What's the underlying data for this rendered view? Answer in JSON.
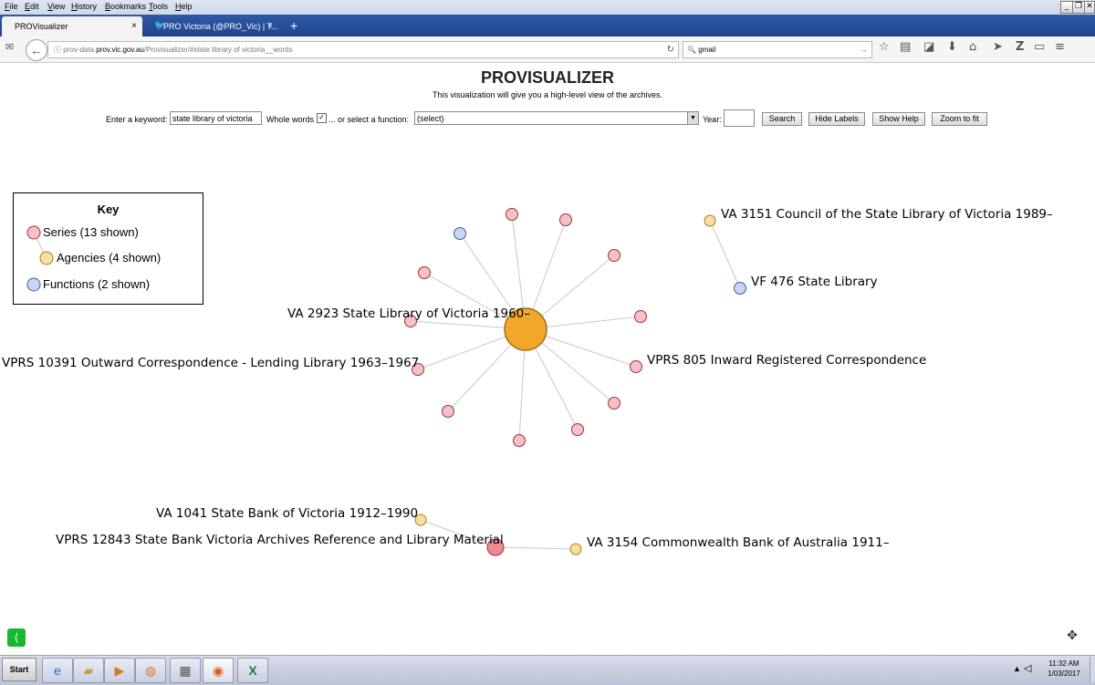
{
  "menu": [
    "File",
    "Edit",
    "View",
    "History",
    "Bookmarks",
    "Tools",
    "Help"
  ],
  "tabs": [
    {
      "title": "PROVisualizer",
      "close": "×"
    },
    {
      "title": "PRO Victoria (@PRO_Vic) | T...",
      "close": "×"
    }
  ],
  "new_tab": "+",
  "nav": {
    "url_prefix": "prov-data.",
    "url_host": "prov.vic.gov.au",
    "url_path": "/Provisualizer/#state library of victoria__words",
    "search_value": "gmail"
  },
  "page": {
    "title": "PROVISUALIZER",
    "subtitle": "This visualization will give you a high-level view of the archives.",
    "keyword_label": "Enter a keyword:",
    "keyword_value": "state library of victoria",
    "whole_words_label": "Whole words",
    "whole_words_checked": "✓",
    "function_label": "... or select a function:",
    "function_value": "(select)",
    "year_label": "Year:",
    "year_value": "",
    "search_btn": "Search",
    "hide_labels_btn": "Hide Labels",
    "show_help_btn": "Show Help",
    "zoom_btn": "Zoom to fit"
  },
  "legend": {
    "title": "Key",
    "series": "Series (13 shown)",
    "agencies": "Agencies (4 shown)",
    "functions": "Functions (2 shown)"
  },
  "colors": {
    "series": "#f4c2c6",
    "series_stroke": "#a0303a",
    "agency": "#f7dfa0",
    "agency_stroke": "#a08020",
    "agency_big": "#f2a72a",
    "function": "#c8d6f2",
    "function_stroke": "#3a5fa8",
    "link": "#c8c8c8"
  },
  "graph": {
    "labels": {
      "va2923": "VA 2923 State Library of Victoria 1960–",
      "vprs10391": "VPRS 10391 Outward Correspondence - Lending Library 1963–1967",
      "vprs805": "VPRS 805 Inward Registered Correspondence",
      "va3151": "VA 3151 Council of the State Library of Victoria 1989–",
      "vf476": "VF 476 State Library",
      "va1041": "VA 1041 State Bank of Victoria 1912–1990",
      "vprs12843": "VPRS 12843 State Bank Victoria Archives Reference and Library Material",
      "va3154": "VA 3154 Commonwealth Bank of Australia 1911–"
    }
  },
  "taskbar": {
    "start": "Start",
    "time": "11:32 AM",
    "date": "1/03/2017"
  }
}
